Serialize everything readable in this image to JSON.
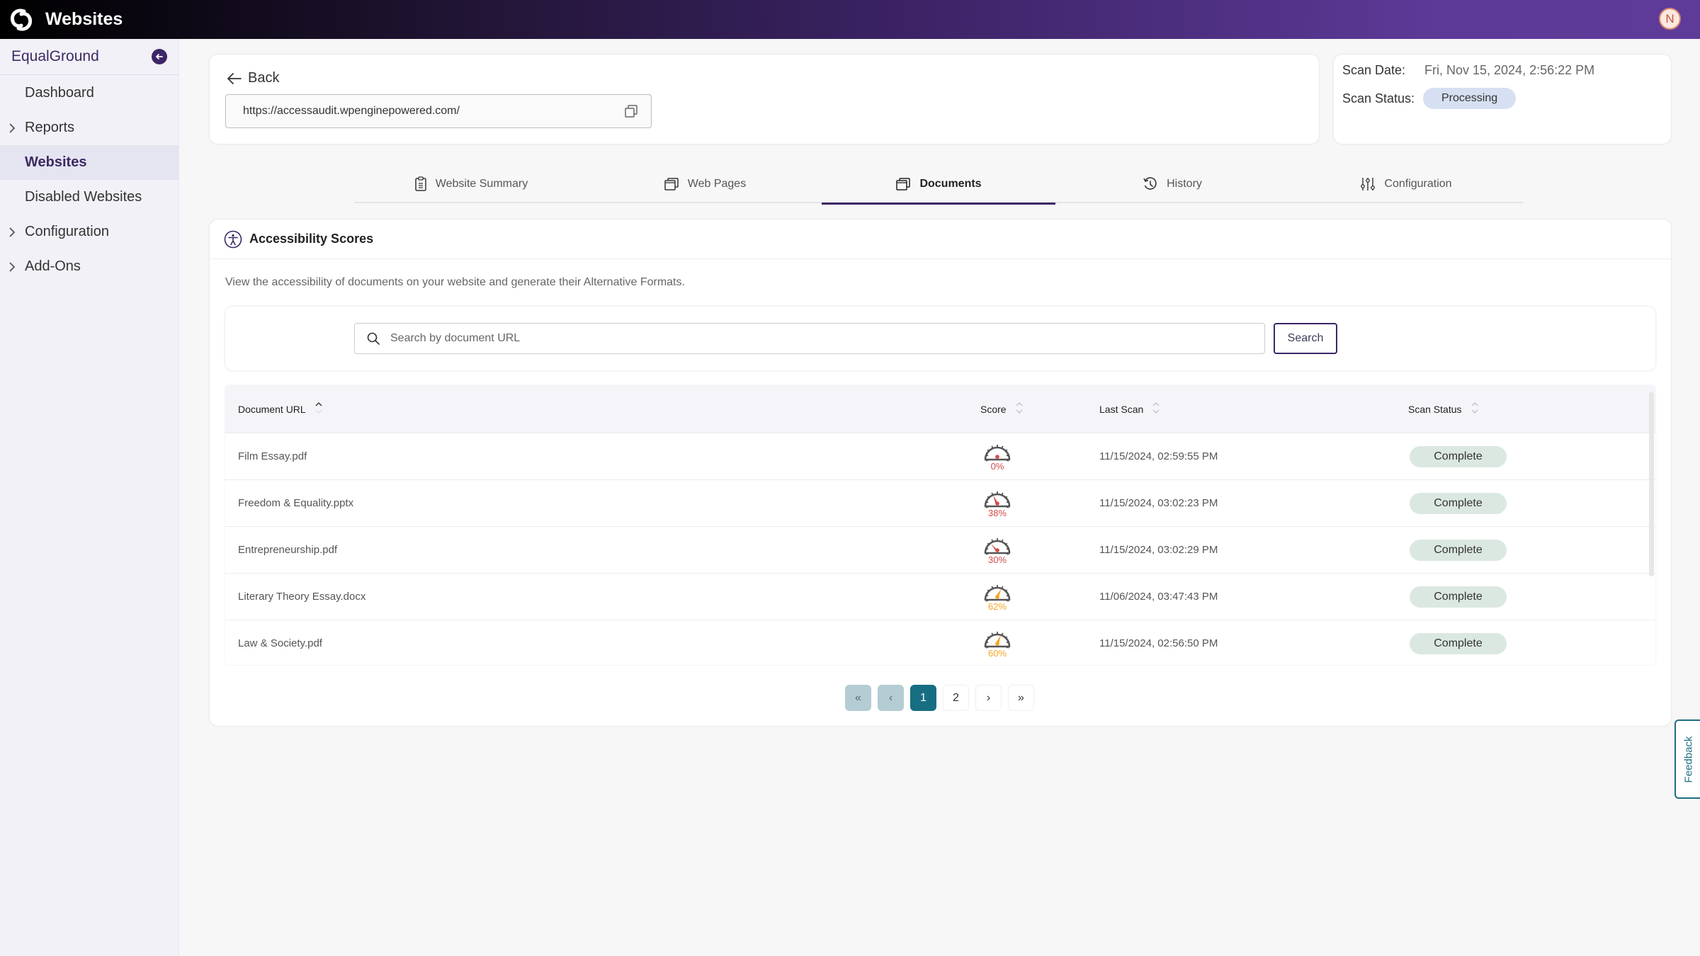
{
  "header": {
    "app_title": "Websites",
    "avatar_initial": "N"
  },
  "sidebar": {
    "org_name": "EqualGround",
    "items": [
      {
        "label": "Dashboard",
        "expandable": false,
        "active": false
      },
      {
        "label": "Reports",
        "expandable": true,
        "active": false
      },
      {
        "label": "Websites",
        "expandable": false,
        "active": true
      },
      {
        "label": "Disabled Websites",
        "expandable": false,
        "active": false
      },
      {
        "label": "Configuration",
        "expandable": true,
        "active": false
      },
      {
        "label": "Add-Ons",
        "expandable": true,
        "active": false
      }
    ]
  },
  "url_card": {
    "back_label": "Back",
    "url": "https://accessaudit.wpenginepowered.com/"
  },
  "scan_card": {
    "date_label": "Scan Date:",
    "date_value": "Fri, Nov 15, 2024, 2:56:22 PM",
    "status_label": "Scan Status:",
    "status_value": "Processing"
  },
  "tabs": [
    {
      "label": "Website Summary",
      "icon": "clipboard-icon",
      "active": false
    },
    {
      "label": "Web Pages",
      "icon": "pages-icon",
      "active": false
    },
    {
      "label": "Documents",
      "icon": "documents-icon",
      "active": true
    },
    {
      "label": "History",
      "icon": "history-icon",
      "active": false
    },
    {
      "label": "Configuration",
      "icon": "sliders-icon",
      "active": false
    }
  ],
  "main": {
    "title": "Accessibility Scores",
    "description": "View the accessibility of documents on your website and generate their Alternative Formats.",
    "search_placeholder": "Search by document URL",
    "search_button": "Search",
    "columns": [
      "Document URL",
      "Score",
      "Last Scan",
      "Scan Status"
    ],
    "rows": [
      {
        "url": "Film Essay.pdf",
        "score": 0,
        "score_label": "0%",
        "last_scan": "11/15/2024, 02:59:55 PM",
        "status": "Complete"
      },
      {
        "url": "Freedom & Equality.pptx",
        "score": 38,
        "score_label": "38%",
        "last_scan": "11/15/2024, 03:02:23 PM",
        "status": "Complete"
      },
      {
        "url": "Entrepreneurship.pdf",
        "score": 30,
        "score_label": "30%",
        "last_scan": "11/15/2024, 03:02:29 PM",
        "status": "Complete"
      },
      {
        "url": "Literary Theory Essay.docx",
        "score": 62,
        "score_label": "62%",
        "last_scan": "11/06/2024, 03:47:43 PM",
        "status": "Complete"
      },
      {
        "url": "Law & Society.pdf",
        "score": 60,
        "score_label": "60%",
        "last_scan": "11/15/2024, 02:56:50 PM",
        "status": "Complete"
      }
    ]
  },
  "pagination": {
    "first": "«",
    "prev": "‹",
    "pages": [
      "1",
      "2"
    ],
    "current": "1",
    "next": "›",
    "last": "»"
  },
  "feedback_label": "Feedback",
  "colors": {
    "brand_purple": "#3d2668",
    "score_low": "#d24b4b",
    "score_mid": "#f5a623",
    "pager_current": "#176e82",
    "complete_badge": "#dbe8e1",
    "processing_badge": "#d6e0f2"
  }
}
